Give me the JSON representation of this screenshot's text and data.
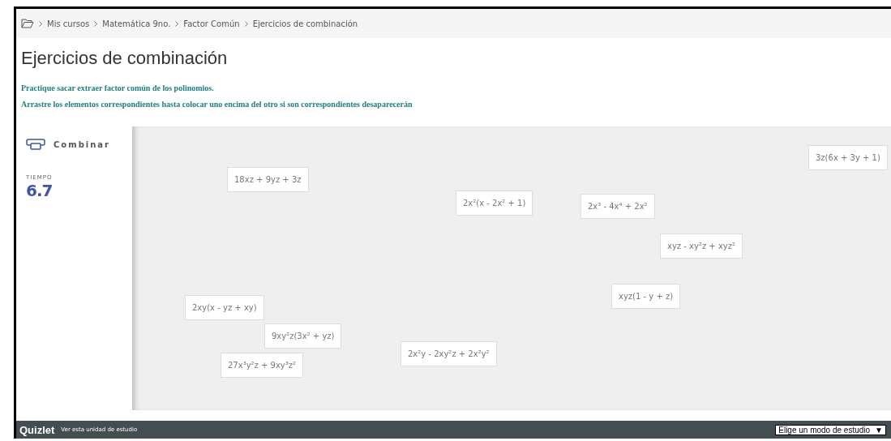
{
  "breadcrumb": [
    "Mis cursos",
    "Matemática 9no.",
    "Factor Común",
    "Ejercicios de combinación"
  ],
  "title": "Ejercicios de combinación",
  "instructions": [
    "Practique sacar extraer factor común de los  polinomios.",
    "Arrastre los elementos correspondientes hasta colocar uno encima del otro si son correspondientes desaparecerán"
  ],
  "sidebar": {
    "mode": "Combinar",
    "timer_label": "TIEMPO",
    "timer_value": "6.7"
  },
  "cards": [
    {
      "text": "3z(6x + 3y + 1)"
    },
    {
      "text": "18xz + 9yz + 3z"
    },
    {
      "text": "2x²(x - 2x² + 1)"
    },
    {
      "text": "2x³ - 4x⁴ + 2x²"
    },
    {
      "text": "xyz - xy²z + xyz²"
    },
    {
      "text": "xyz(1 - y + z)"
    },
    {
      "text": "2xy(x - yz + xy)"
    },
    {
      "text": "9xy²z(3x² + yz)"
    },
    {
      "text": "2x²y - 2xy²z + 2x²y²"
    },
    {
      "text": "27x³y²z + 9xy³z²"
    }
  ],
  "footer": {
    "logo": "Quizlet",
    "link": "Ver esta unidad de estudio",
    "select": "Elige un modo de estudio",
    "select_arrow": "▼"
  }
}
